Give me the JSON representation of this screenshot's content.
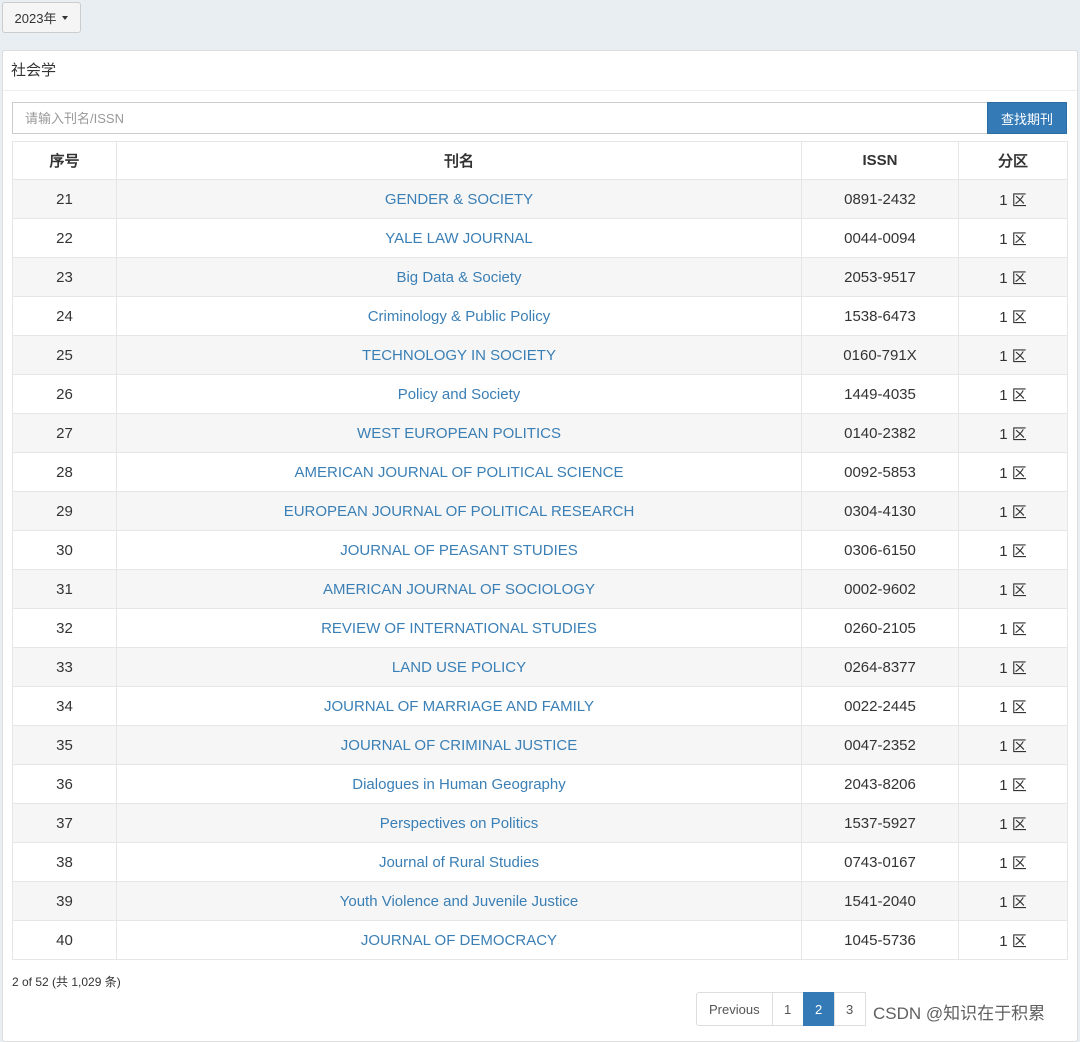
{
  "header": {
    "year_label": "2023年"
  },
  "panel": {
    "title": "社会学"
  },
  "search": {
    "placeholder": "请输入刊名/ISSN",
    "button_label": "查找期刊"
  },
  "table": {
    "headers": [
      "序号",
      "刊名",
      "ISSN",
      "分区"
    ],
    "rows": [
      {
        "no": "21",
        "name": "GENDER & SOCIETY",
        "issn": "0891-2432",
        "zone": "1 区"
      },
      {
        "no": "22",
        "name": "YALE LAW JOURNAL",
        "issn": "0044-0094",
        "zone": "1 区"
      },
      {
        "no": "23",
        "name": "Big Data & Society",
        "issn": "2053-9517",
        "zone": "1 区"
      },
      {
        "no": "24",
        "name": "Criminology & Public Policy",
        "issn": "1538-6473",
        "zone": "1 区"
      },
      {
        "no": "25",
        "name": "TECHNOLOGY IN SOCIETY",
        "issn": "0160-791X",
        "zone": "1 区"
      },
      {
        "no": "26",
        "name": "Policy and Society",
        "issn": "1449-4035",
        "zone": "1 区"
      },
      {
        "no": "27",
        "name": "WEST EUROPEAN POLITICS",
        "issn": "0140-2382",
        "zone": "1 区"
      },
      {
        "no": "28",
        "name": "AMERICAN JOURNAL OF POLITICAL SCIENCE",
        "issn": "0092-5853",
        "zone": "1 区"
      },
      {
        "no": "29",
        "name": "EUROPEAN JOURNAL OF POLITICAL RESEARCH",
        "issn": "0304-4130",
        "zone": "1 区"
      },
      {
        "no": "30",
        "name": "JOURNAL OF PEASANT STUDIES",
        "issn": "0306-6150",
        "zone": "1 区"
      },
      {
        "no": "31",
        "name": "AMERICAN JOURNAL OF SOCIOLOGY",
        "issn": "0002-9602",
        "zone": "1 区"
      },
      {
        "no": "32",
        "name": "REVIEW OF INTERNATIONAL STUDIES",
        "issn": "0260-2105",
        "zone": "1 区"
      },
      {
        "no": "33",
        "name": "LAND USE POLICY",
        "issn": "0264-8377",
        "zone": "1 区"
      },
      {
        "no": "34",
        "name": "JOURNAL OF MARRIAGE AND FAMILY",
        "issn": "0022-2445",
        "zone": "1 区"
      },
      {
        "no": "35",
        "name": "JOURNAL OF CRIMINAL JUSTICE",
        "issn": "0047-2352",
        "zone": "1 区"
      },
      {
        "no": "36",
        "name": "Dialogues in Human Geography",
        "issn": "2043-8206",
        "zone": "1 区"
      },
      {
        "no": "37",
        "name": "Perspectives on Politics",
        "issn": "1537-5927",
        "zone": "1 区"
      },
      {
        "no": "38",
        "name": "Journal of Rural Studies",
        "issn": "0743-0167",
        "zone": "1 区"
      },
      {
        "no": "39",
        "name": "Youth Violence and Juvenile Justice",
        "issn": "1541-2040",
        "zone": "1 区"
      },
      {
        "no": "40",
        "name": "JOURNAL OF DEMOCRACY",
        "issn": "1045-5736",
        "zone": "1 区"
      }
    ]
  },
  "footer": {
    "summary": "2 of 52 (共 1,029 条)"
  },
  "pagination": {
    "previous_label": "Previous",
    "pages": [
      "1",
      "2",
      "3"
    ],
    "current": "2"
  },
  "watermark": {
    "text": "CSDN @知识在于积累"
  },
  "colors": {
    "accent": "#337ab7",
    "link": "#3a7fb5"
  }
}
